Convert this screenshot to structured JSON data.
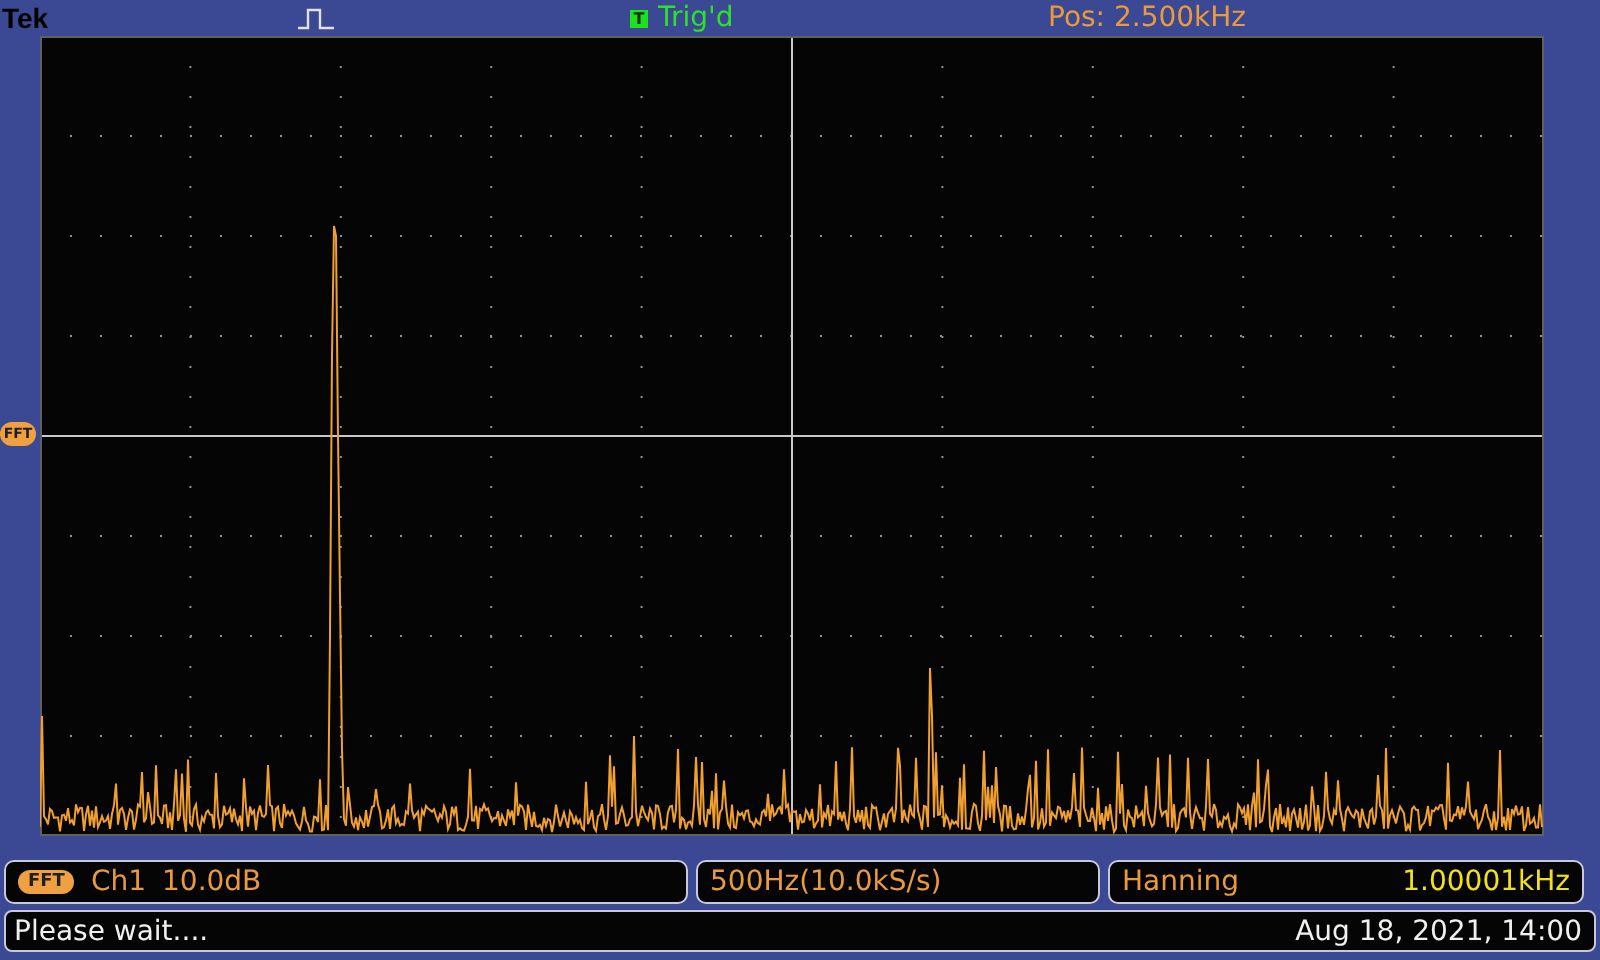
{
  "header": {
    "brand": "Tek",
    "trigger_badge": "T",
    "trigger_status": "Trig'd",
    "position": "Pos: 2.500kHz"
  },
  "screen": {
    "marker": "FFT"
  },
  "readouts": {
    "channel_badge": "FFT",
    "channel": "Ch1",
    "scale": "10.0dB",
    "span": "500Hz(10.0kS/s)",
    "window": "Hanning",
    "frequency": "1.00001kHz"
  },
  "status_bar": {
    "message": "Please wait....",
    "datetime": "Aug 18, 2021, 14:00"
  }
}
